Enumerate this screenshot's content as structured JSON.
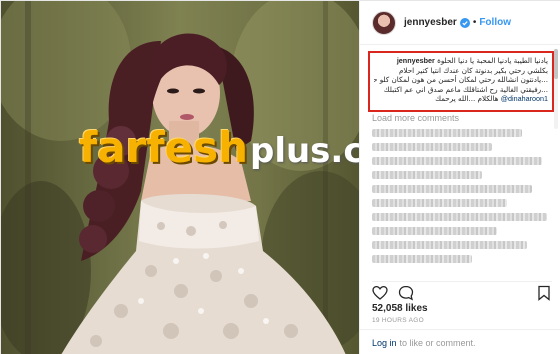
{
  "header": {
    "username": "jennyesber",
    "separator": "•",
    "follow_label": "Follow"
  },
  "caption": {
    "username": "jennyesber",
    "lines": [
      "يادنيا الطيبة يادنيا المحبة يا دنيا الحلوة",
      "بكلشي رحتي بكير بدنوتة كان عندك انتيا كتير احلام",
      "...يادنتون انشالله رحتي لمكان أحسن من هون لمكان كلو حب",
      "...رفيقتي الغالية رح اشتاقلك ماعم صدق اني عم اكتبلك",
      "هالكلام ...الله يرحمك"
    ],
    "mention": "@dinaharoon1"
  },
  "load_more_label": "Load more comments",
  "watermark": {
    "brand": "farfesh",
    "suffix": "plus.com"
  },
  "likes_text": "52,058 likes",
  "time_text": "19 HOURS AGO",
  "login": {
    "link_label": "Log in",
    "rest_label": "to like or comment."
  },
  "icons": [
    "heart-icon",
    "comment-icon",
    "save-icon",
    "verified-icon"
  ],
  "colors": {
    "follow_blue": "#3897f0",
    "highlight_red": "#d9271d",
    "watermark_orange": "#f7b100"
  }
}
